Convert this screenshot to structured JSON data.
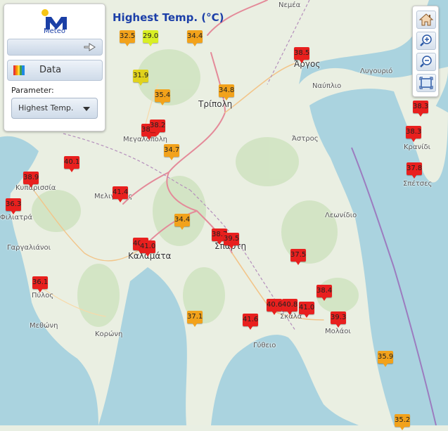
{
  "title": "Highest Temp. (°C)",
  "logo": {
    "text": "Meteo"
  },
  "panel": {
    "data_button": "Data",
    "parameter_label": "Parameter:",
    "parameter_value": "Highest Temp."
  },
  "toolbar": {
    "buttons": [
      "home-icon",
      "zoom-in-icon",
      "zoom-out-icon",
      "extent-icon"
    ]
  },
  "colors": {
    "very_hot": "#e8201e",
    "hot": "#f2a21b",
    "warm": "#e0d21c",
    "mild": "#d9ef25",
    "land": "#eaefe2",
    "sea": "#aad3df",
    "border": "#b08ab6"
  },
  "places": [
    {
      "name": "Νεμέα"
    },
    {
      "name": "Άργος"
    },
    {
      "name": "Ναύπλιο"
    },
    {
      "name": "Λυγουριό"
    },
    {
      "name": "Τρίπολη"
    },
    {
      "name": "Άστρος"
    },
    {
      "name": "Κρανίδι"
    },
    {
      "name": "Σπέτσες"
    },
    {
      "name": "Μεγαλόπολη"
    },
    {
      "name": "Κυπαρισσία"
    },
    {
      "name": "Φιλιατρά"
    },
    {
      "name": "Μελιγαλάς"
    },
    {
      "name": "Γαργαλιάνοι"
    },
    {
      "name": "Καλαμάτα"
    },
    {
      "name": "Σπάρτη"
    },
    {
      "name": "Λεωνίδιο"
    },
    {
      "name": "Πύλος"
    },
    {
      "name": "Μεθώνη"
    },
    {
      "name": "Κορώνη"
    },
    {
      "name": "Σκάλα"
    },
    {
      "name": "Μολάοι"
    },
    {
      "name": "Γύθειο"
    }
  ],
  "stations": [
    {
      "value": "32.5",
      "level": "hot"
    },
    {
      "value": "29.0",
      "level": "mild"
    },
    {
      "value": "34.4",
      "level": "hot"
    },
    {
      "value": "38.5",
      "level": "very_hot"
    },
    {
      "value": "31.9",
      "level": "warm"
    },
    {
      "value": "35.4",
      "level": "hot"
    },
    {
      "value": "34.8",
      "level": "hot"
    },
    {
      "value": "38.3",
      "level": "very_hot"
    },
    {
      "value": "38.1",
      "level": "very_hot"
    },
    {
      "value": "38.2",
      "level": "very_hot"
    },
    {
      "value": "38.3",
      "level": "very_hot"
    },
    {
      "value": "34.7",
      "level": "hot"
    },
    {
      "value": "40.1",
      "level": "very_hot"
    },
    {
      "value": "37.8",
      "level": "very_hot"
    },
    {
      "value": "38.9",
      "level": "very_hot"
    },
    {
      "value": "41.4",
      "level": "very_hot"
    },
    {
      "value": "36.3",
      "level": "very_hot"
    },
    {
      "value": "34.4",
      "level": "hot"
    },
    {
      "value": "38.7",
      "level": "very_hot"
    },
    {
      "value": "39.5",
      "level": "very_hot"
    },
    {
      "value": "40.4",
      "level": "very_hot"
    },
    {
      "value": "41.0",
      "level": "very_hot"
    },
    {
      "value": "37.5",
      "level": "very_hot"
    },
    {
      "value": "36.1",
      "level": "very_hot"
    },
    {
      "value": "38.4",
      "level": "very_hot"
    },
    {
      "value": "37.1",
      "level": "hot"
    },
    {
      "value": "40.6",
      "level": "very_hot"
    },
    {
      "value": "40.8",
      "level": "very_hot"
    },
    {
      "value": "41.0",
      "level": "very_hot"
    },
    {
      "value": "41.6",
      "level": "very_hot"
    },
    {
      "value": "39.3",
      "level": "very_hot"
    },
    {
      "value": "35.9",
      "level": "hot"
    },
    {
      "value": "35.2",
      "level": "hot"
    }
  ]
}
